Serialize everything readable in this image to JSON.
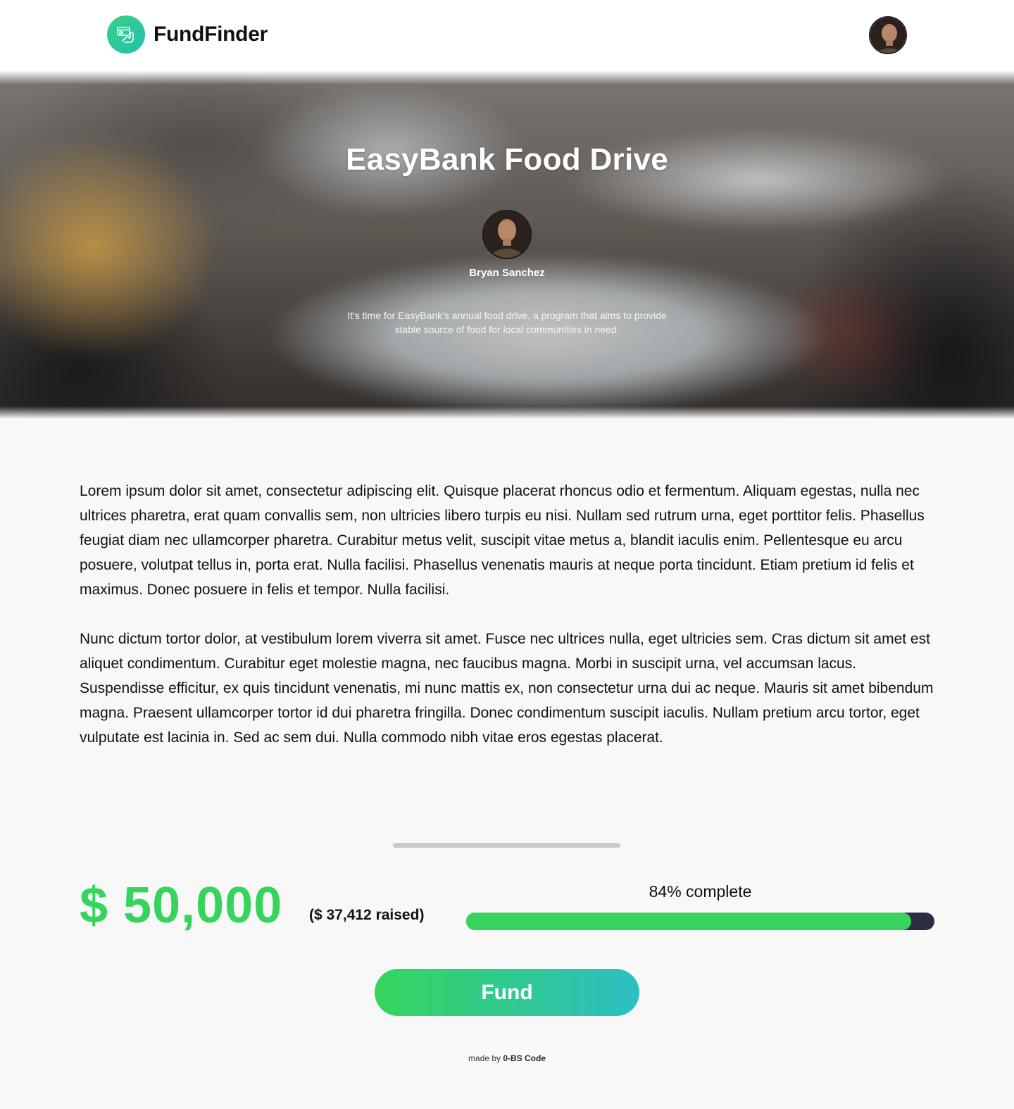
{
  "header": {
    "brand_name": "FundFinder",
    "logo_icon": "card-hand-icon",
    "avatar_icon": "user-avatar"
  },
  "hero": {
    "title": "EasyBank Food Drive",
    "author": "Bryan Sanchez",
    "description": "It's time for EasyBank's annual food drive, a program that aims to provide stable source of food for local communities in need."
  },
  "content": {
    "paragraphs": [
      " Lorem ipsum dolor sit amet, consectetur adipiscing elit. Quisque placerat rhoncus odio et fermentum. Aliquam egestas, nulla nec ultrices pharetra, erat quam convallis sem, non ultricies libero turpis eu nisi. Nullam sed rutrum urna, eget porttitor felis. Phasellus feugiat diam nec ullamcorper pharetra. Curabitur metus velit, suscipit vitae metus a, blandit iaculis enim. Pellentesque eu arcu posuere, volutpat tellus in, porta erat. Nulla facilisi. Phasellus venenatis mauris at neque porta tincidunt. Etiam pretium id felis et maximus. Donec posuere in felis et tempor. Nulla facilisi.",
      "Nunc dictum tortor dolor, at vestibulum lorem viverra sit amet. Fusce nec ultrices nulla, eget ultricies sem. Cras dictum sit amet est aliquet condimentum. Curabitur eget molestie magna, nec faucibus magna. Morbi in suscipit urna, vel accumsan lacus. Suspendisse efficitur, ex quis tincidunt venenatis, mi nunc mattis ex, non consectetur urna dui ac neque. Mauris sit amet bibendum magna. Praesent ullamcorper tortor id dui pharetra fringilla. Donec condimentum suscipit iaculis. Nullam pretium arcu tortor, eget vulputate est lacinia in. Sed ac sem dui. Nulla commodo nibh vitae eros egestas placerat."
    ]
  },
  "funding": {
    "goal": "$ 50,000",
    "raised": "($ 37,412 raised)",
    "progress_label": "84% complete",
    "progress_fraction": 0.95,
    "button_label": "Fund"
  },
  "footer": {
    "prefix": "made by",
    "link": "0-BS Code"
  },
  "colors": {
    "accent_green": "#36d45c",
    "accent_teal": "#2cbfc4",
    "track_dark": "#2a2d44",
    "background": "#f8f8f8"
  }
}
